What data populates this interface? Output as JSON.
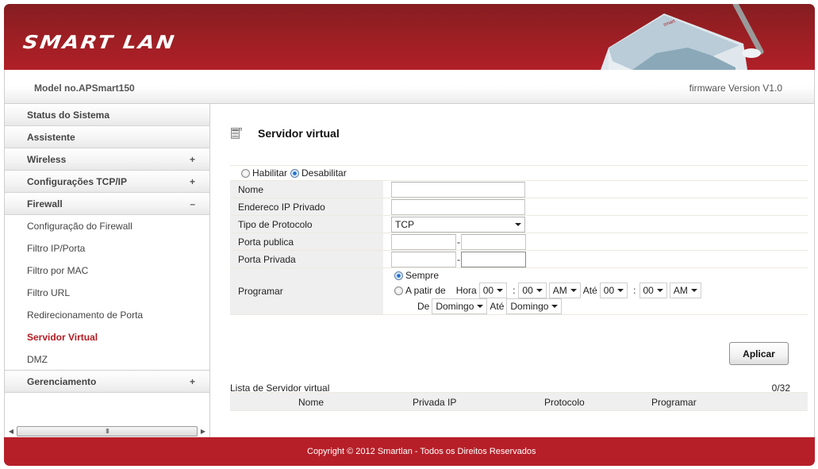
{
  "header": {
    "brand": "SMART LAN",
    "model": "Model no.APSmart150",
    "firmware": "firmware Version V1.0",
    "colors": {
      "brand_red": "#b11f27",
      "active_red": "#b31b22"
    }
  },
  "sidebar": {
    "items": [
      {
        "label": "Status do Sistema",
        "type": "main",
        "sign": ""
      },
      {
        "label": "Assistente",
        "type": "main",
        "sign": ""
      },
      {
        "label": "Wireless",
        "type": "main",
        "sign": "+"
      },
      {
        "label": "Configurações TCP/IP",
        "type": "main",
        "sign": "+"
      },
      {
        "label": "Firewall",
        "type": "main",
        "sign": "–"
      },
      {
        "label": "Configuração do Firewall",
        "type": "sub"
      },
      {
        "label": "Filtro IP/Porta",
        "type": "sub"
      },
      {
        "label": "Filtro por MAC",
        "type": "sub"
      },
      {
        "label": "Filtro URL",
        "type": "sub"
      },
      {
        "label": "Redirecionamento de Porta",
        "type": "sub"
      },
      {
        "label": "Servidor Virtual",
        "type": "sub",
        "active": true
      },
      {
        "label": "DMZ",
        "type": "sub"
      },
      {
        "label": "Gerenciamento",
        "type": "main",
        "sign": "+"
      }
    ],
    "scrollbar": {
      "left": "◀",
      "right": "▶",
      "grip": "III"
    }
  },
  "main": {
    "title": "Servidor virtual",
    "enable": {
      "enable_label": "Habilitar",
      "disable_label": "Desabilitar",
      "selected": "Desabilitar"
    },
    "fields": {
      "name": {
        "label": "Nome",
        "value": ""
      },
      "private_ip": {
        "label": "Endereco IP Privado",
        "value": ""
      },
      "protocol": {
        "label": "Tipo de Protocolo",
        "value": "TCP"
      },
      "public_port": {
        "label": "Porta publica",
        "from": "",
        "to": "",
        "sep": "-"
      },
      "private_port": {
        "label": "Porta Privada",
        "from": "",
        "to": "",
        "sep": "-"
      },
      "schedule": {
        "label": "Programar",
        "always_label": "Sempre",
        "from_label": "A patir de",
        "hour_label": "Hora",
        "until_label": "Até",
        "day_label": "De",
        "colon": ":",
        "selected": "Sempre",
        "start_hour": "00",
        "start_min": "00",
        "start_ampm": "AM",
        "end_hour": "00",
        "end_min": "00",
        "end_ampm": "AM",
        "start_day": "Domingo",
        "end_day": "Domingo"
      }
    },
    "apply_label": "Aplicar",
    "list": {
      "title": "Lista de Servidor virtual",
      "count": "0/32",
      "columns": [
        "Nome",
        "Privada IP",
        "Protocolo",
        "Programar"
      ],
      "rows": []
    }
  },
  "footer": {
    "copyright": "Copyright © 2012 Smartlan - Todos os Direitos Reservados"
  }
}
